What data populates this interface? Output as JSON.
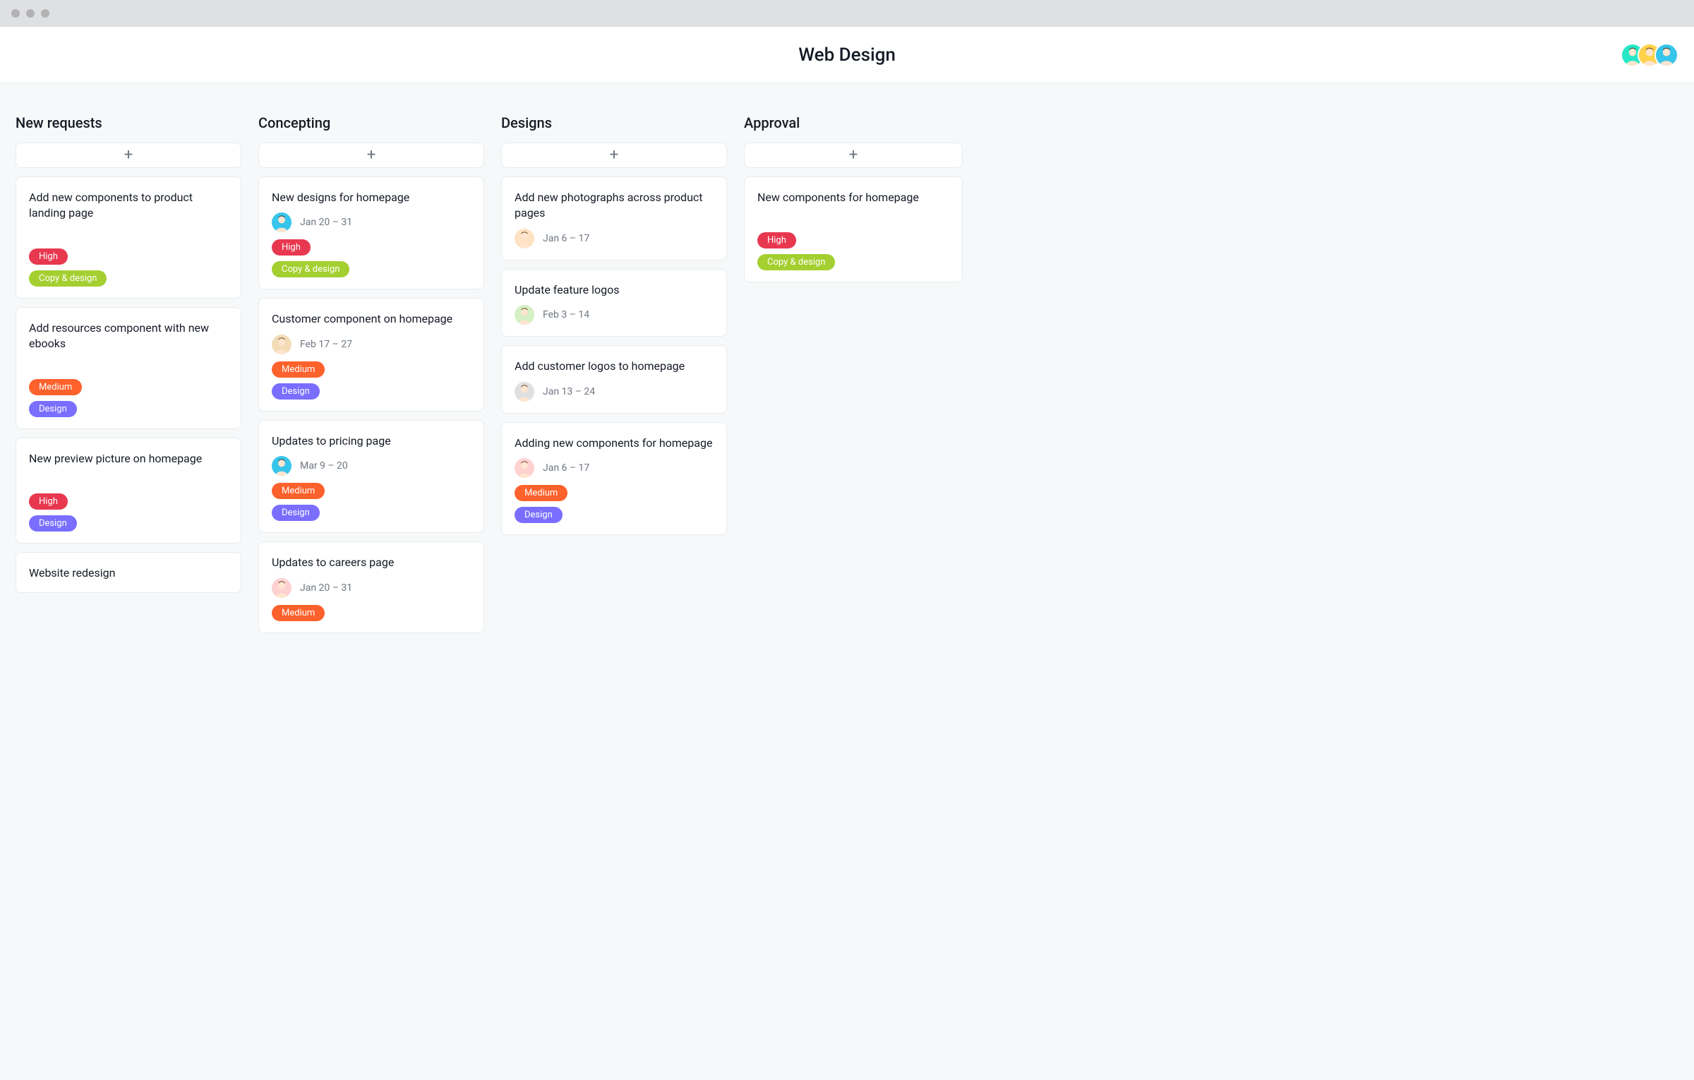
{
  "header": {
    "title": "Web Design"
  },
  "tag_labels": {
    "high": "High",
    "medium": "Medium",
    "design": "Design",
    "copy_design": "Copy & design"
  },
  "columns": [
    {
      "title": "New requests",
      "cards": [
        {
          "title": "Add new components to product landing page",
          "assignee": null,
          "date": null,
          "tags": [
            "high",
            "copy_design"
          ],
          "spacer": true
        },
        {
          "title": "Add resources component with new ebooks",
          "assignee": null,
          "date": null,
          "tags": [
            "medium",
            "design"
          ],
          "spacer": true
        },
        {
          "title": "New preview picture on homepage",
          "assignee": null,
          "date": null,
          "tags": [
            "high",
            "design"
          ],
          "spacer": true
        },
        {
          "title": "Website redesign",
          "assignee": null,
          "date": null,
          "tags": [],
          "spacer": false
        }
      ]
    },
    {
      "title": "Concepting",
      "cards": [
        {
          "title": "New designs for homepage",
          "assignee": "a2",
          "date": "Jan 20 – 31",
          "tags": [
            "high",
            "copy_design"
          ],
          "spacer": false
        },
        {
          "title": "Customer component on homepage",
          "assignee": "a6",
          "date": "Feb 17 – 27",
          "tags": [
            "medium",
            "design"
          ],
          "spacer": false
        },
        {
          "title": "Updates to pricing page",
          "assignee": "a2",
          "date": "Mar 9 – 20",
          "tags": [
            "medium",
            "design"
          ],
          "spacer": false
        },
        {
          "title": "Updates to careers page",
          "assignee": "a3",
          "date": "Jan 20 – 31",
          "tags": [
            "medium"
          ],
          "spacer": false
        }
      ]
    },
    {
      "title": "Designs",
      "cards": [
        {
          "title": "Add new photographs across product pages",
          "assignee": "a4",
          "date": "Jan 6 – 17",
          "tags": [],
          "spacer": false
        },
        {
          "title": "Update feature logos",
          "assignee": "a5",
          "date": "Feb 3 – 14",
          "tags": [],
          "spacer": false
        },
        {
          "title": "Add customer logos to homepage",
          "assignee": "a7",
          "date": "Jan 13 – 24",
          "tags": [],
          "spacer": false
        },
        {
          "title": "Adding new components for homepage",
          "assignee": "a3",
          "date": "Jan 6 – 17",
          "tags": [
            "medium",
            "design"
          ],
          "spacer": false
        }
      ]
    },
    {
      "title": "Approval",
      "cards": [
        {
          "title": "New components for homepage",
          "assignee": null,
          "date": null,
          "tags": [
            "high",
            "copy_design"
          ],
          "spacer": true
        }
      ]
    }
  ],
  "avatar_colors": {
    "a1": "#25e8c8",
    "a2": "#37c5eb",
    "a3": "#ffd1d1",
    "a4": "#ffe2c3",
    "a5": "#d5f0c4",
    "a6": "#f2dcb8",
    "a7": "#e0e0e0",
    "h1": "#25e8c8",
    "h2": "#ffd24a",
    "h3": "#37c5eb"
  }
}
